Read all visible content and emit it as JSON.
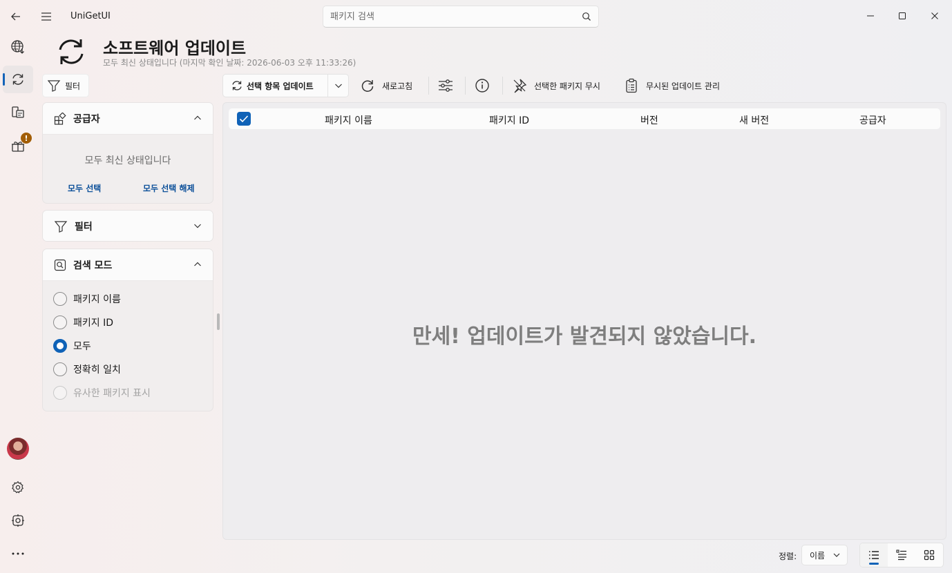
{
  "window": {
    "app_title": "UniGetUI",
    "search_placeholder": "패키지 검색"
  },
  "page": {
    "title": "소프트웨어 업데이트",
    "subtitle": "모두 최신 상태입니다 (마지막 확인 날짜: 2026-06-03 오후 11:33:26)"
  },
  "sidebar": {
    "filter_toggle_label": "필터",
    "sources": {
      "title": "공급자",
      "empty_text": "모두 최신 상태입니다",
      "select_all": "모두 선택",
      "deselect_all": "모두 선택 해제"
    },
    "filters": {
      "title": "필터"
    },
    "search_mode": {
      "title": "검색 모드",
      "options": [
        {
          "label": "패키지 이름",
          "checked": false,
          "enabled": true
        },
        {
          "label": "패키지 ID",
          "checked": false,
          "enabled": true
        },
        {
          "label": "모두",
          "checked": true,
          "enabled": true
        },
        {
          "label": "정확히 일치",
          "checked": false,
          "enabled": true
        },
        {
          "label": "유사한 패키지 표시",
          "checked": false,
          "enabled": false
        }
      ]
    }
  },
  "toolbar": {
    "update_selected": "선택 항목 업데이트",
    "refresh": "새로고침",
    "ignore_selected": "선택한 패키지 무시",
    "manage_ignored": "무시된 업데이트 관리"
  },
  "table": {
    "columns": {
      "name": "패키지 이름",
      "id": "패키지 ID",
      "version": "버전",
      "new_version": "새 버전",
      "source": "공급자"
    },
    "header_checked": true,
    "empty_message": "만세! 업데이트가 발견되지 않았습니다."
  },
  "nav": {
    "bundles_badge": "!"
  },
  "footer": {
    "sort_label": "정렬:",
    "sort_value": "이름"
  },
  "colors": {
    "accent": "#0f62b7",
    "link": "#0b4f99",
    "badge": "#a25d06"
  }
}
